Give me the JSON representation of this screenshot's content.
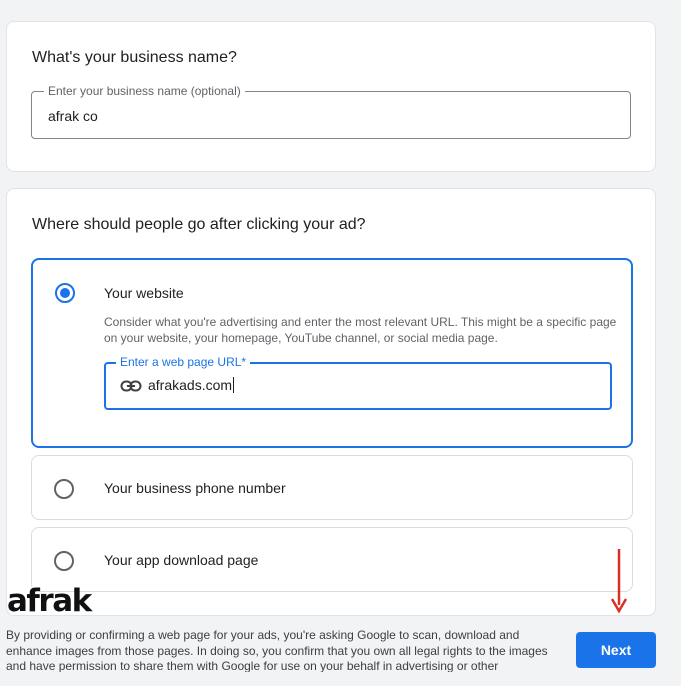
{
  "business": {
    "heading": "What's your business name?",
    "field_label": "Enter your business name (optional)",
    "field_value": "afrak co"
  },
  "destination": {
    "heading": "Where should people go after clicking your ad?",
    "options": [
      {
        "label": "Your website",
        "selected": true,
        "description": "Consider what you're advertising and enter the most relevant URL. This might be a specific page on your website, your homepage, YouTube channel, or social media page.",
        "url_label": "Enter a web page URL*",
        "url_value": "afrakads.com",
        "url_icon": "link-icon"
      },
      {
        "label": "Your business phone number",
        "selected": false
      },
      {
        "label": "Your app download page",
        "selected": false
      }
    ]
  },
  "footer": {
    "text": "By providing or confirming a web page for your ads, you're asking Google to scan, download and enhance images from those pages. In doing so, you confirm that you own all legal rights to the images and have permission to share them with Google for use on your behalf in advertising or other commercial purposes.",
    "next_label": "Next"
  },
  "watermark": {
    "text": "afrak"
  },
  "colors": {
    "accent": "#1a73e8",
    "annotation_arrow": "#d93025"
  }
}
